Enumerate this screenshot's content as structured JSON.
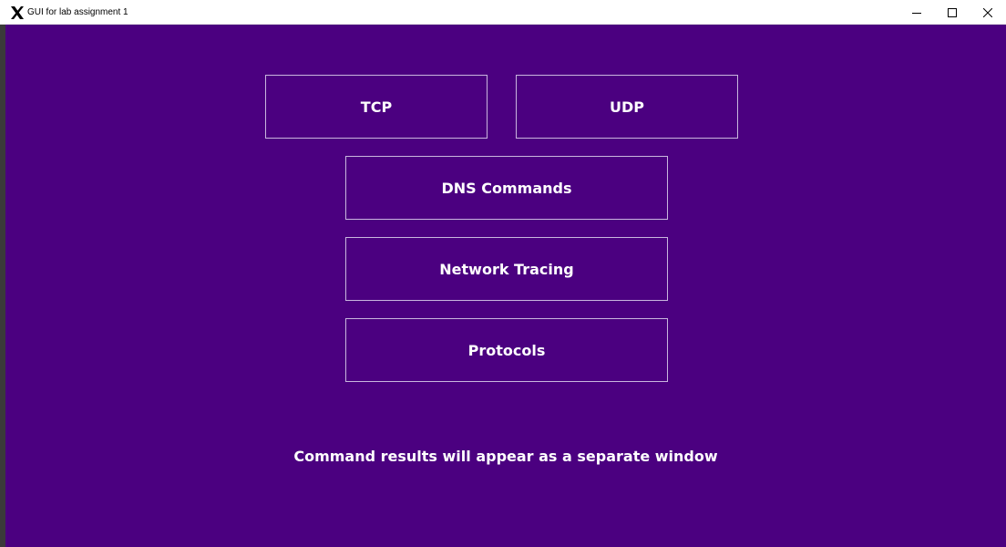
{
  "window": {
    "title": "GUI for lab assignment 1",
    "app_icon": "x-logo-icon",
    "controls": {
      "minimize_icon": "minimize-icon",
      "maximize_icon": "maximize-icon",
      "close_icon": "close-icon"
    }
  },
  "colors": {
    "background": "#4b0080",
    "button_border": "#c9b6de",
    "text": "#ffffff",
    "titlebar": "#ffffff"
  },
  "buttons": {
    "tcp": "TCP",
    "udp": "UDP",
    "dns": "DNS Commands",
    "tracing": "Network Tracing",
    "protocols": "Protocols"
  },
  "info_message": "Command results will appear as a separate window"
}
